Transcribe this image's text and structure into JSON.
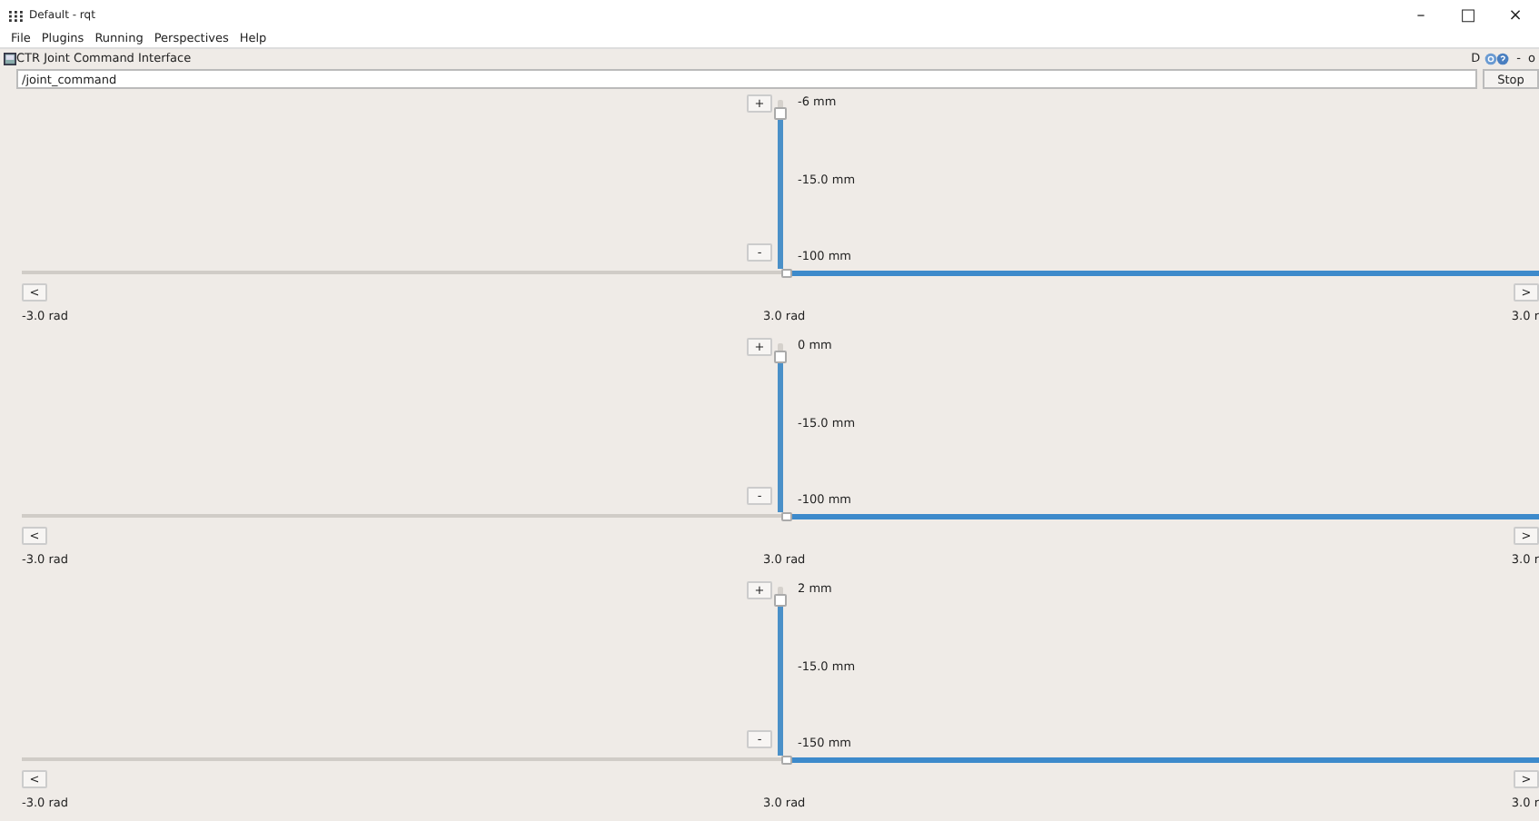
{
  "window": {
    "title": "Default - rqt",
    "controls": [
      "–",
      "□",
      "×"
    ]
  },
  "menu": [
    {
      "label": "File"
    },
    {
      "label": "Plugins"
    },
    {
      "label": "Running"
    },
    {
      "label": "Perspectives"
    },
    {
      "label": "Help"
    }
  ],
  "plugin": {
    "title": "CTR Joint Command Interface",
    "buttons": [
      "D",
      "-",
      "o"
    ]
  },
  "topic": {
    "value": "/joint_command"
  },
  "stop_button": "Stop",
  "joints": [
    {
      "increase": "+",
      "decrease": "-",
      "top_label": "-6 mm",
      "mid_label": "-15.0 mm",
      "bottom_label": "-100 mm",
      "rotation": {
        "level": 0.5
      },
      "prev": "<",
      "next": ">",
      "min_label": "-3.0 rad",
      "center_label": "3.0 rad",
      "max_label": "3.0 r"
    },
    {
      "increase": "+",
      "decrease": "-",
      "top_label": "0 mm",
      "mid_label": "-15.0 mm",
      "bottom_label": "-100 mm",
      "rotation": {
        "level": 0.5
      },
      "prev": "<",
      "next": ">",
      "min_label": "-3.0 rad",
      "center_label": "3.0 rad",
      "max_label": "3.0 r"
    },
    {
      "increase": "+",
      "decrease": "-",
      "top_label": "2 mm",
      "mid_label": "-15.0 mm",
      "bottom_label": "-150 mm",
      "rotation": {
        "level": 0.5
      },
      "prev": "<",
      "next": ">",
      "min_label": "-3.0 rad",
      "center_label": "3.0 rad",
      "max_label": "3.0 r"
    }
  ]
}
